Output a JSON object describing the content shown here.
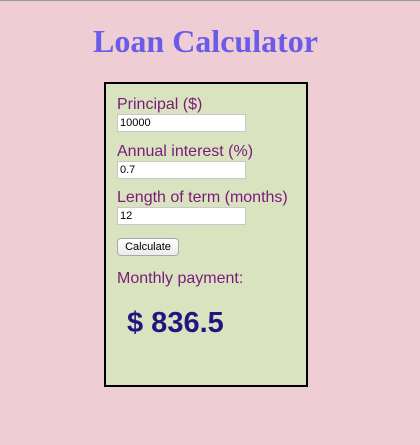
{
  "page": {
    "title": "Loan Calculator"
  },
  "form": {
    "principal_label": "Principal ($)",
    "principal_value": "10000",
    "interest_label": "Annual interest (%)",
    "interest_value": "0.7",
    "term_label": "Length of term (months)",
    "term_value": "12",
    "calculate_label": "Calculate"
  },
  "result": {
    "label": "Monthly payment:",
    "value": "$ 836.5"
  },
  "colors": {
    "background": "#efcdd4",
    "title": "#6a5be8",
    "panel": "#dae3c0",
    "label_text": "#7a1a7a",
    "result_text": "#22157f"
  }
}
